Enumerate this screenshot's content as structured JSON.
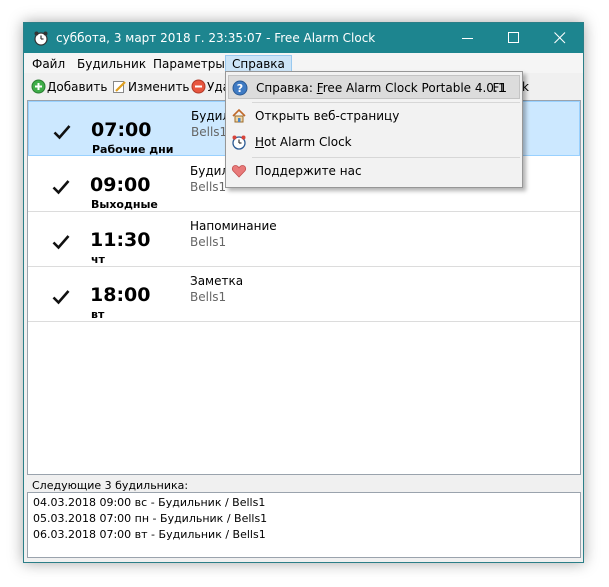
{
  "window": {
    "title": "суббота, 3 март 2018 г. 23:35:07 - Free Alarm Clock",
    "controls": [
      "minimize",
      "maximize",
      "close"
    ]
  },
  "menubar": {
    "items": [
      {
        "label": "Файл"
      },
      {
        "label": "Будильник"
      },
      {
        "label": "Параметры"
      },
      {
        "label": "Справка",
        "active": true
      }
    ]
  },
  "toolbar": {
    "add_label": "Добавить",
    "edit_label": "Изменить",
    "delete_label_visible": "Уда",
    "hidden_tail": "k"
  },
  "alarms": [
    {
      "checked": true,
      "time": "07:00",
      "days": "Рабочие дни",
      "name": "Будил",
      "sound": "Bells1",
      "selected": true
    },
    {
      "checked": true,
      "time": "09:00",
      "days": "Выходные",
      "name": "Будил",
      "sound": "Bells1"
    },
    {
      "checked": true,
      "time": "11:30",
      "days": "чт",
      "name": "Напоминание",
      "sound": "Bells1"
    },
    {
      "checked": true,
      "time": "18:00",
      "days": "вт",
      "name": "Заметка",
      "sound": "Bells1"
    }
  ],
  "next": {
    "label": "Следующие 3 будильника:",
    "items": [
      "04.03.2018 09:00 вс - Будильник / Bells1",
      "05.03.2018 07:00 пн - Будильник / Bells1",
      "06.03.2018 07:00 вт - Будильник / Bells1"
    ]
  },
  "help_menu": {
    "items": [
      {
        "prefix": "Справка: ",
        "underline": "F",
        "rest": "ree Alarm Clock Portable 4.0.1",
        "shortcut": "F1",
        "icon": "help-icon",
        "highlighted": true
      },
      {
        "prefix": "",
        "underline": "",
        "rest": "Открыть веб-страницу",
        "icon": "home-icon"
      },
      {
        "prefix": "",
        "underline": "H",
        "rest": "ot Alarm Clock",
        "icon": "alarm-clock-icon"
      },
      {
        "prefix": "",
        "underline": "",
        "rest": "Поддержите нас",
        "icon": "heart-icon"
      }
    ]
  },
  "colors": {
    "titlebar": "#1d858f",
    "selection": "#cce8ff",
    "menu_active": "#cce4f7"
  }
}
